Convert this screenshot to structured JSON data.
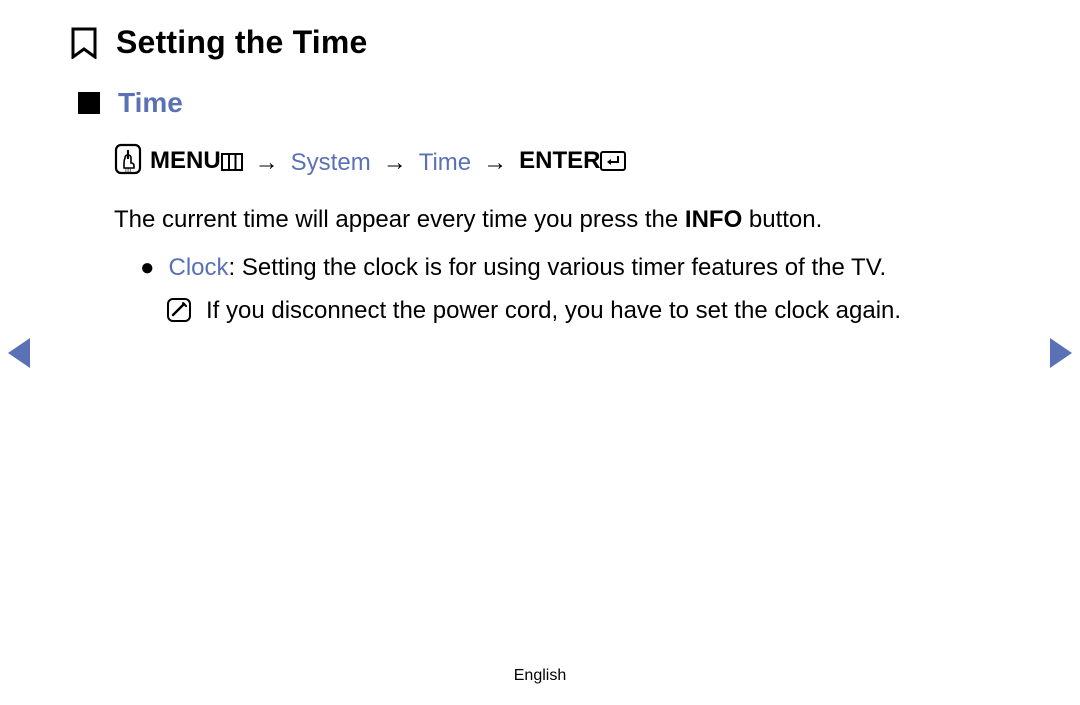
{
  "title": "Setting the Time",
  "section": "Time",
  "path": {
    "menu": "MENU",
    "step1": "System",
    "step2": "Time",
    "enter": "ENTER",
    "arrow": "→"
  },
  "desc": {
    "pre": "The current time will appear every time you press the ",
    "bold": "INFO",
    "post": " button."
  },
  "bullet": {
    "label": "Clock",
    "text": ": Setting the clock is for using various timer features of the TV."
  },
  "note": "If you disconnect the power cord, you have to set the clock again.",
  "footer": "English"
}
